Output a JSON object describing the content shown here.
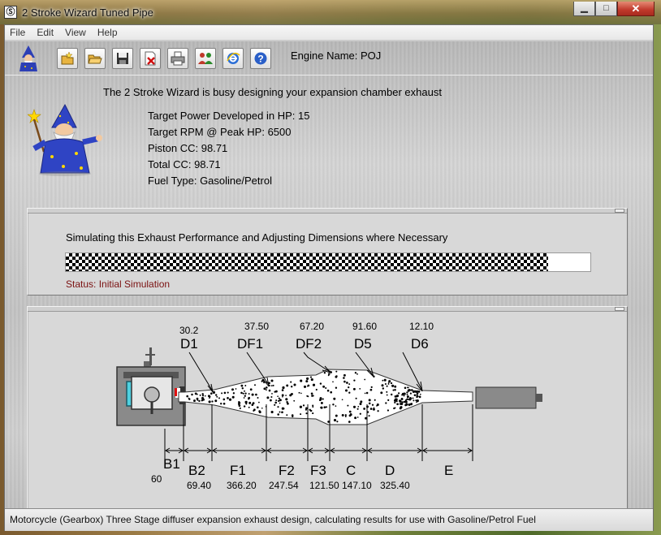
{
  "window": {
    "title": "2 Stroke Wizard Tuned Pipe"
  },
  "menu": [
    "File",
    "Edit",
    "View",
    "Help"
  ],
  "toolbar": {
    "buttons": [
      {
        "name": "new-icon"
      },
      {
        "name": "open-icon"
      },
      {
        "name": "save-icon"
      },
      {
        "name": "delete-icon"
      },
      {
        "name": "print-icon"
      },
      {
        "name": "people-icon"
      },
      {
        "name": "internet-explorer-icon"
      },
      {
        "name": "help-icon"
      }
    ],
    "engine_name": "Engine Name: POJ"
  },
  "busy_text": "The 2 Stroke Wizard is busy designing your expansion chamber exhaust",
  "info": [
    "Target Power Developed in HP: 15",
    "Target RPM @ Peak HP: 6500",
    "Piston CC: 98.71",
    "Total CC: 98.71",
    "Fuel Type: Gasoline/Petrol"
  ],
  "simulation": {
    "label": "Simulating this Exhaust Performance and Adjusting Dimensions where Necessary",
    "progress": 0.92,
    "status": "Status: Initial Simulation"
  },
  "diagram": {
    "diameters": [
      {
        "name": "D1",
        "value": "30.2"
      },
      {
        "name": "DF1",
        "value": "37.50"
      },
      {
        "name": "DF2",
        "value": "67.20"
      },
      {
        "name": "D5",
        "value": "91.60"
      },
      {
        "name": "D6",
        "value": "12.10"
      }
    ],
    "sections": [
      {
        "name": "B1",
        "value": "60"
      },
      {
        "name": "B2",
        "value": "69.40"
      },
      {
        "name": "F1",
        "value": "366.20"
      },
      {
        "name": "F2",
        "value": "247.54"
      },
      {
        "name": "F3",
        "value": "121.50"
      },
      {
        "name": "C",
        "value": "147.10"
      },
      {
        "name": "D",
        "value": "325.40"
      },
      {
        "name": "E",
        "value": ""
      }
    ]
  },
  "statusbar": "Motorcycle (Gearbox) Three Stage diffuser expansion exhaust design, calculating results for use with Gasoline/Petrol Fuel"
}
